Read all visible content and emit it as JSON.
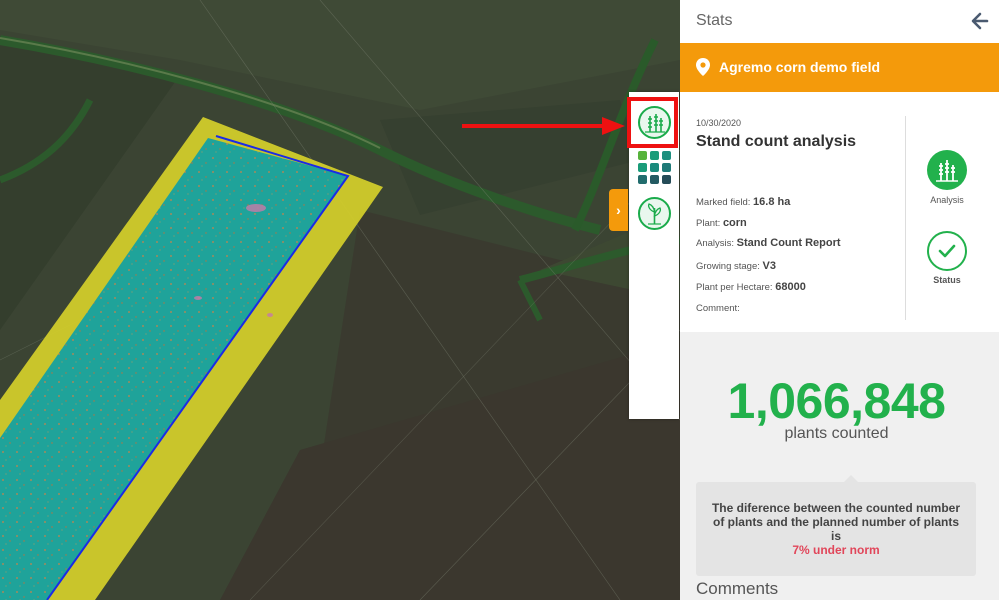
{
  "panel": {
    "title": "Stats",
    "field_name": "Agremo corn demo field",
    "date": "10/30/2020",
    "analysis_title": "Stand count analysis",
    "info": {
      "marked_field_label": "Marked field:",
      "marked_field_value": "16.8 ha",
      "plant_label": "Plant:",
      "plant_value": "corn",
      "analysis_label": "Analysis:",
      "analysis_value": "Stand Count Report",
      "growing_stage_label": "Growing stage:",
      "growing_stage_value": "V3",
      "plant_per_hectare_label": "Plant per Hectare:",
      "plant_per_hectare_value": "68000",
      "comment_label": "Comment:"
    },
    "analysis_badge_label": "Analysis",
    "status_badge_label": "Status",
    "plants_counted_value": "1,066,848",
    "plants_counted_caption": "plants counted",
    "difference_note": "The diference between the counted number of plants and the planned number of plants is",
    "difference_highlight": "7% under norm",
    "comments_title": "Comments"
  },
  "icons": {
    "back": "arrow-left-icon",
    "location": "map-pin-icon",
    "analysis": "crop-analysis-icon",
    "zones": "grid-icon",
    "plant": "plant-icon",
    "status": "checkmark-icon",
    "expand": "chevron-right-icon"
  },
  "colors": {
    "accent": "#f49a0b",
    "green": "#22b14c",
    "alert": "#e1465a",
    "highlight_red": "#ee1111",
    "field_overlay": "#1fa39a",
    "field_border": "#d6d02a"
  }
}
